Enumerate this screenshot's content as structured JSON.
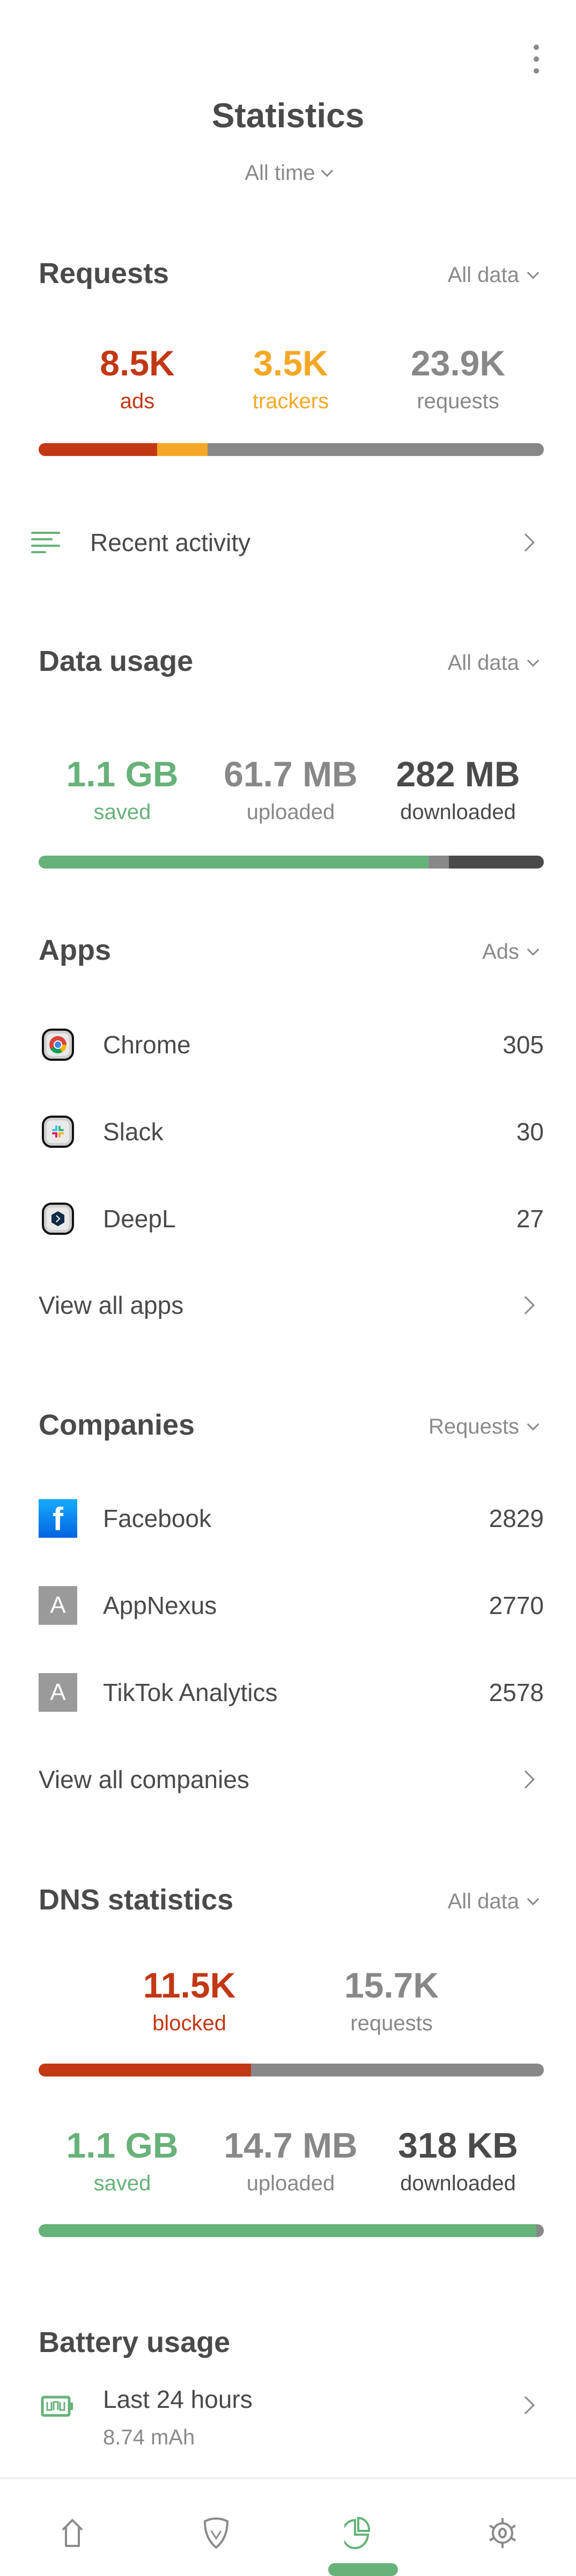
{
  "header": {
    "title": "Statistics",
    "period": "All time",
    "menu_icon": "more-vert-icon"
  },
  "colors": {
    "accent_green": "#67b279",
    "ads_red": "#c23814",
    "trackers_orange": "#f4a825",
    "neutral_gray": "#888888",
    "dark_gray": "#4a4a4a"
  },
  "requests": {
    "title": "Requests",
    "filter": "All data",
    "stats": [
      {
        "value": "8.5K",
        "label": "ads"
      },
      {
        "value": "3.5K",
        "label": "trackers"
      },
      {
        "value": "23.9K",
        "label": "requests"
      }
    ],
    "bar_fractions": {
      "ads": 0.235,
      "trackers": 0.099,
      "other": 0.666
    }
  },
  "recent_activity": {
    "label": "Recent activity",
    "icon": "sort-lines-icon"
  },
  "data_usage": {
    "title": "Data usage",
    "filter": "All data",
    "stats": [
      {
        "value": "1.1 GB",
        "label": "saved"
      },
      {
        "value": "61.7 MB",
        "label": "uploaded"
      },
      {
        "value": "282 MB",
        "label": "downloaded"
      }
    ],
    "bar_fractions": {
      "saved": 0.772,
      "uploaded": 0.04,
      "downloaded": 0.188
    }
  },
  "apps": {
    "title": "Apps",
    "filter": "Ads",
    "items": [
      {
        "name": "Chrome",
        "count": "305",
        "icon": "chrome-icon"
      },
      {
        "name": "Slack",
        "count": "30",
        "icon": "slack-icon"
      },
      {
        "name": "DeepL",
        "count": "27",
        "icon": "deepl-icon"
      }
    ],
    "view_all": "View all apps"
  },
  "companies": {
    "title": "Companies",
    "filter": "Requests",
    "items": [
      {
        "name": "Facebook",
        "count": "2829",
        "icon": "facebook-icon",
        "letter": "f"
      },
      {
        "name": "AppNexus",
        "count": "2770",
        "icon": "letter-a-icon",
        "letter": "A"
      },
      {
        "name": "TikTok Analytics",
        "count": "2578",
        "icon": "letter-a-icon",
        "letter": "A"
      }
    ],
    "view_all": "View all companies"
  },
  "dns": {
    "title": "DNS statistics",
    "filter": "All data",
    "stats": [
      {
        "value": "11.5K",
        "label": "blocked"
      },
      {
        "value": "15.7K",
        "label": "requests"
      }
    ],
    "bar_fractions": {
      "blocked": 0.42,
      "other": 0.58
    },
    "data_stats": [
      {
        "value": "1.1 GB",
        "label": "saved"
      },
      {
        "value": "14.7 MB",
        "label": "uploaded"
      },
      {
        "value": "318 KB",
        "label": "downloaded"
      }
    ],
    "data_bar_fractions": {
      "saved": 0.985,
      "uploaded": 0.015,
      "downloaded": 0.0
    }
  },
  "battery": {
    "title": "Battery usage",
    "period": "Last 24 hours",
    "value": "8.74 mAh",
    "icon": "battery-icon"
  },
  "bottom_nav": {
    "items": [
      {
        "name": "home",
        "icon": "home-icon",
        "active": false
      },
      {
        "name": "protection",
        "icon": "shield-check-icon",
        "active": false
      },
      {
        "name": "statistics",
        "icon": "pie-chart-icon",
        "active": true
      },
      {
        "name": "settings",
        "icon": "gear-icon",
        "active": false
      }
    ]
  }
}
